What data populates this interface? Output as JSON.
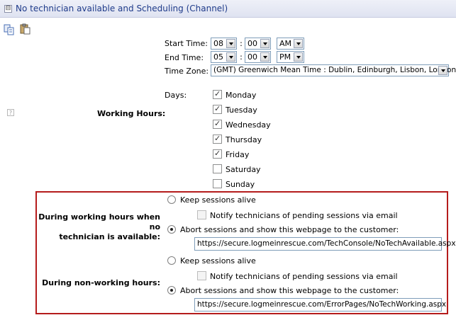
{
  "header": {
    "title": "No technician available and Scheduling (Channel)",
    "toggle_symbol": "⊟"
  },
  "toolbar": {
    "icons": [
      "copy-icon",
      "paste-icon"
    ]
  },
  "schedule": {
    "start_label": "Start Time:",
    "start_hour": "08",
    "start_minute": "00",
    "start_ampm": "AM",
    "end_label": "End Time:",
    "end_hour": "05",
    "end_minute": "00",
    "end_ampm": "PM",
    "colon": ":",
    "timezone_label": "Time Zone:",
    "timezone_value": "(GMT) Greenwich Mean Time : Dublin, Edinburgh, Lisbon, London",
    "working_hours_label": "Working Hours:",
    "days_label": "Days:",
    "days": [
      {
        "name": "Monday",
        "checked": true
      },
      {
        "name": "Tuesday",
        "checked": true
      },
      {
        "name": "Wednesday",
        "checked": true
      },
      {
        "name": "Thursday",
        "checked": true
      },
      {
        "name": "Friday",
        "checked": true
      },
      {
        "name": "Saturday",
        "checked": false
      },
      {
        "name": "Sunday",
        "checked": false
      }
    ]
  },
  "working_no_tech": {
    "label_line1": "During working hours when no",
    "label_line2": "technician is available:",
    "keep_alive": "Keep sessions alive",
    "notify": "Notify technicians of pending sessions via email",
    "abort": "Abort sessions and show this webpage to the customer:",
    "url": "https://secure.logmeinrescue.com/TechConsole/NoTechAvailable.aspx"
  },
  "non_working": {
    "label": "During non-working hours:",
    "keep_alive": "Keep sessions alive",
    "notify": "Notify technicians of pending sessions via email",
    "abort": "Abort sessions and show this webpage to the customer:",
    "url": "https://secure.logmeinrescue.com/ErrorPages/NoTechWorking.aspx"
  },
  "help_icon": "?",
  "colors": {
    "highlight_border": "#b51c1c",
    "header_text": "#1f3b8a"
  }
}
